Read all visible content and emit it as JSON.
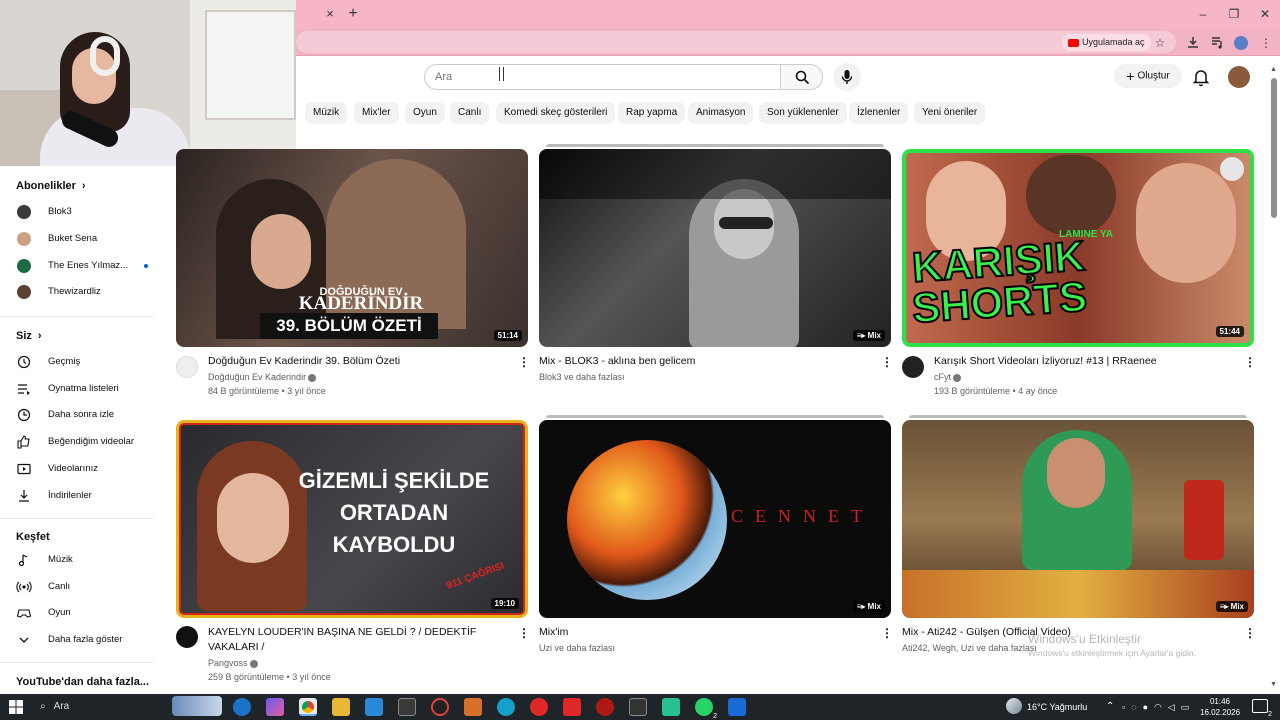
{
  "browser": {
    "tab_close": "×",
    "new_tab": "+",
    "open_in_app": "Uygulamada aç",
    "window_controls": [
      "–",
      "❐",
      "✕"
    ]
  },
  "header": {
    "search_placeholder": "Ara",
    "create_label": "Oluştur"
  },
  "chips": [
    "Müzik",
    "Mix'ler",
    "Oyun",
    "Canlı",
    "Komedi skeç gösterileri",
    "Rap yapma",
    "Animasyon",
    "Son yüklenenler",
    "İzlenenler",
    "Yeni öneriler"
  ],
  "sidebar": {
    "subscriptions_title": "Abonelikler",
    "subscriptions": [
      {
        "label": "Blok3",
        "color": "#3a3a3a"
      },
      {
        "label": "Buket Sena",
        "color": "#c9a283"
      },
      {
        "label": "The Enes Yılmaz...",
        "color": "#1f6b46"
      },
      {
        "label": "Thewizardliz",
        "color": "#5a4030"
      }
    ],
    "you_title": "Siz",
    "you_items": [
      {
        "label": "Geçmiş",
        "icon": "history-icon"
      },
      {
        "label": "Oynatma listeleri",
        "icon": "playlists-icon"
      },
      {
        "label": "Daha sonra izle",
        "icon": "watch-later-icon"
      },
      {
        "label": "Beğendiğim videolar",
        "icon": "liked-icon"
      },
      {
        "label": "Videolarınız",
        "icon": "your-videos-icon"
      },
      {
        "label": "İndirilenler",
        "icon": "downloads-icon"
      }
    ],
    "explore_title": "Keşfet",
    "explore_items": [
      {
        "label": "Müzik",
        "icon": "music-icon"
      },
      {
        "label": "Canlı",
        "icon": "live-icon"
      },
      {
        "label": "Oyun",
        "icon": "gaming-icon"
      },
      {
        "label": "Daha fazla göster",
        "icon": "chevron-down-icon"
      }
    ],
    "more_title": "YouTube'dan daha fazla..."
  },
  "videos": [
    {
      "title": "Doğduğun Ev Kaderindir 39. Bölüm Özeti",
      "channel": "Doğduğun Ev Kaderindir",
      "verified": true,
      "stats": "84 B görüntüleme • 3 yıl önce",
      "duration": "51:14",
      "thumb_text_1": "DOĞDUĞUN EV",
      "thumb_text_2": "KADERİNDİR",
      "thumb_text_3": "39. BÖLÜM ÖZETİ",
      "thumb_color": "#4a3a34",
      "channel_color": "#ddd"
    },
    {
      "title": "Mix - BLOK3 - aklına ben gelicem",
      "channel": "Blok3 ve daha fazlası",
      "verified": false,
      "stats": "",
      "duration": "Mix",
      "thumb_color": "#2c2c2c",
      "channel_color": ""
    },
    {
      "title": "Karışık Short Videoları İzliyoruz! #13 | RRaenee",
      "channel": "cFyt",
      "verified": true,
      "stats": "193 B görüntüleme • 4 ay önce",
      "duration": "51:44",
      "thumb_text_1": "LAMINE YA",
      "thumb_text_2": "KARIŞIK",
      "thumb_text_3": "SHORTS",
      "thumb_color": "#b0523a",
      "channel_color": "#222"
    },
    {
      "title": "KAYELYN LOUDER'IN BAŞINA NE GELDİ ? / DEDEKTİF VAKALARI /",
      "channel": "Pangvoss",
      "verified": true,
      "stats": "259 B görüntüleme • 3 yıl önce",
      "duration": "19:10",
      "thumb_text_1": "GİZEMLİ ŞEKİLDE",
      "thumb_text_2": "ORTADAN",
      "thumb_text_3": "KAYBOLDU",
      "thumb_text_4": "911 ÇAĞRISI",
      "thumb_color": "#3b3a3e",
      "channel_color": "#111"
    },
    {
      "title": "Mix'im",
      "channel": "Uzi ve daha fazlası",
      "verified": false,
      "stats": "",
      "duration": "Mix",
      "thumb_text_1": "CENNET",
      "thumb_color": "#0b0b0b",
      "channel_color": ""
    },
    {
      "title": "Mix - Ati242 - Gülşen (Official Video)",
      "channel": "Ati242, Wegh, Uzi ve daha fazlası",
      "verified": false,
      "stats": "",
      "duration": "Mix",
      "thumb_color": "#7a5a3c",
      "channel_color": ""
    }
  ],
  "watermark": {
    "line1": "Windows'u Etkinleştir",
    "line2": "Windows'u etkinleştirmek için Ayarlar'a gidin."
  },
  "taskbar": {
    "search_label": "Ara",
    "weather": "16°C  Yağmurlu",
    "time": "01:46",
    "date": "16.02.2026",
    "notifications": "2",
    "whatsapp_badge": "2"
  }
}
